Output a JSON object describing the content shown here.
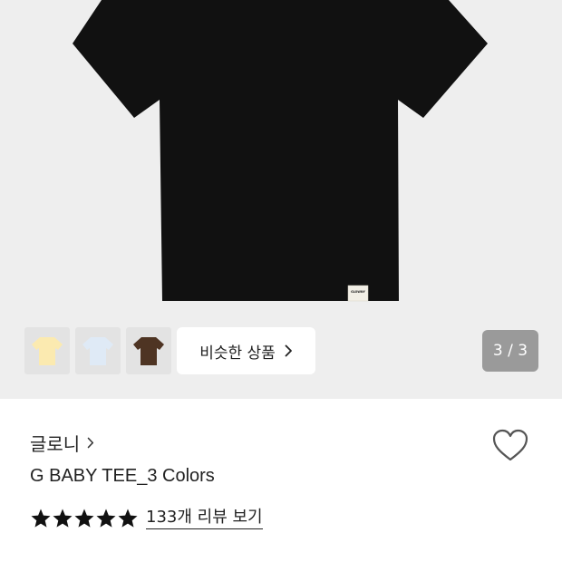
{
  "gallery": {
    "counter_current": "3",
    "counter_separator": " / ",
    "counter_total": "3",
    "label_text": "GLOWNY",
    "thumbnails": [
      {
        "color": "#fbeab0"
      },
      {
        "color": "#dfeaf6"
      },
      {
        "color": "#4e3423"
      }
    ],
    "similar_label": "비슷한 상품"
  },
  "product": {
    "brand": "글로니",
    "title": "G BABY TEE_3 Colors",
    "rating_stars": 5,
    "reviews_label": "133개 리뷰 보기",
    "main_color": "#111111",
    "background_color": "#eeeeee"
  }
}
